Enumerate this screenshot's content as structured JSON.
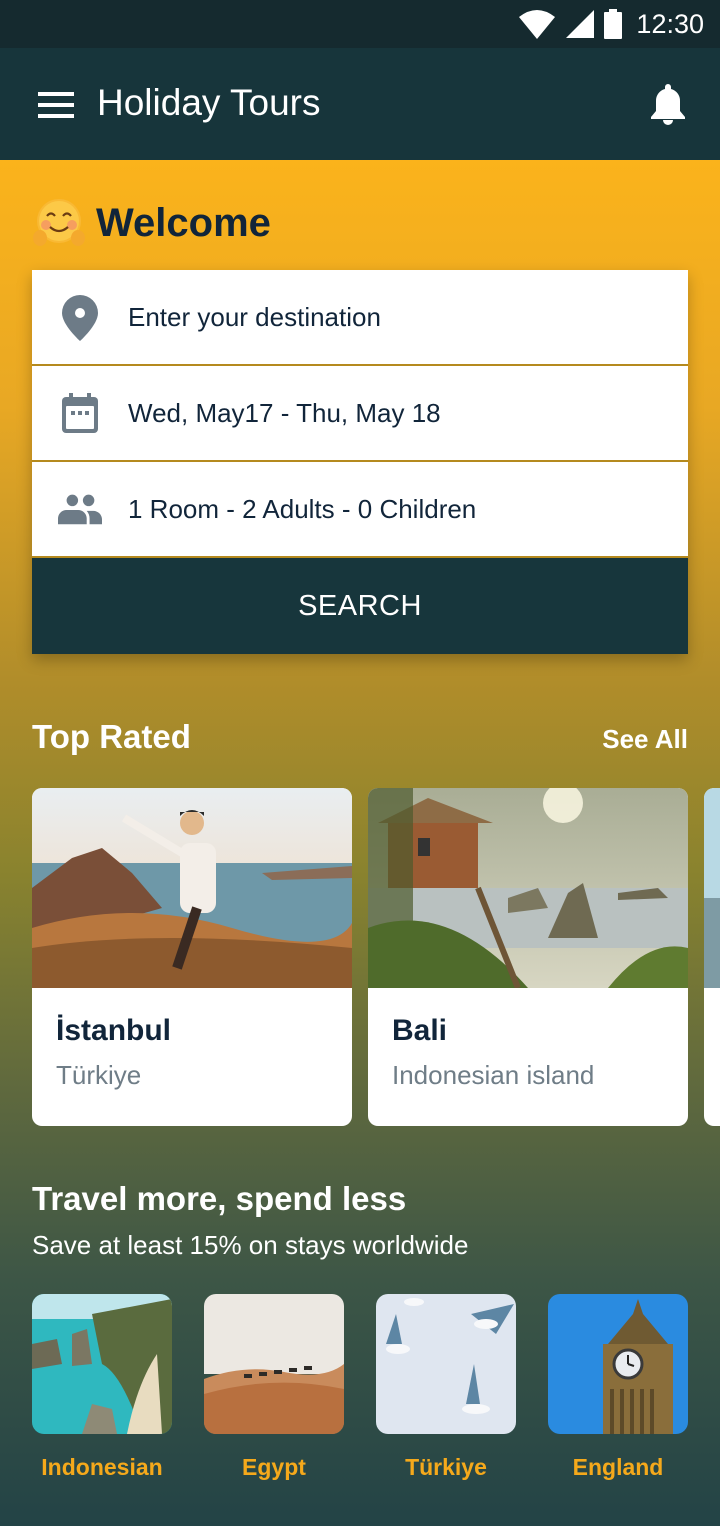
{
  "status_bar": {
    "time": "12:30",
    "icons": [
      "wifi-icon",
      "signal-icon",
      "battery-icon"
    ]
  },
  "app_bar": {
    "title": "Holiday Tours",
    "menu_icon": "menu-icon",
    "notification_icon": "bell-icon"
  },
  "welcome": {
    "emoji": "hugging-face-emoji",
    "text": "Welcome"
  },
  "search_form": {
    "destination": {
      "icon": "location-pin-icon",
      "placeholder": "Enter your destination",
      "value": ""
    },
    "dates": {
      "icon": "calendar-icon",
      "value": "Wed, May17 - Thu, May 18"
    },
    "guests": {
      "icon": "people-icon",
      "value": "1 Room - 2 Adults - 0 Children"
    },
    "search_label": "SEARCH"
  },
  "top_rated": {
    "title": "Top Rated",
    "see_all": "See All",
    "cards": [
      {
        "title": "İstanbul",
        "subtitle": "Türkiye",
        "image": "hiker-on-coastal-hill-photo"
      },
      {
        "title": "Bali",
        "subtitle": "Indonesian island",
        "image": "treehouse-cliffs-photo"
      },
      {
        "title": "",
        "subtitle": "",
        "image": "beach-waves-photo"
      }
    ]
  },
  "promo": {
    "title": "Travel more, spend less",
    "subtitle": "Save at least 15% on stays worldwide"
  },
  "destinations": [
    {
      "label": "Indonesian",
      "image": "turquoise-bay-cliffs-photo"
    },
    {
      "label": "Egypt",
      "image": "desert-camels-photo"
    },
    {
      "label": "Türkiye",
      "image": "seagulls-photo"
    },
    {
      "label": "England",
      "image": "big-ben-photo"
    }
  ],
  "colors": {
    "app_bar": "#17353b",
    "status_bar": "#152a2f",
    "accent_yellow": "#fbb31b",
    "destination_label": "#f5a91b",
    "text_dark": "#11253a",
    "text_muted": "#6f7d87"
  }
}
